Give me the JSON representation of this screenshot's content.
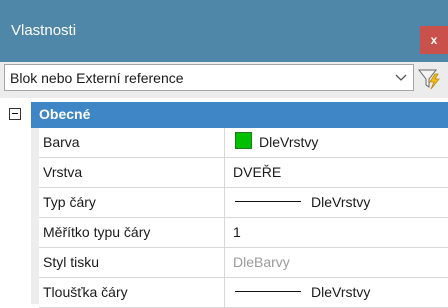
{
  "panel": {
    "title": "Vlastnosti",
    "close_glyph": "x"
  },
  "selector": {
    "value": "Blok nebo Externí reference",
    "chevron_icon": "chevron-down-icon",
    "quick_select_icon": "funnel-lightning-icon"
  },
  "category": {
    "label": "Obecné",
    "expander": "collapse-minus-icon"
  },
  "properties": [
    {
      "name": "Barva",
      "value": "DleVrstvy",
      "swatch_color": "#00c000"
    },
    {
      "name": "Vrstva",
      "value": "DVEŘE"
    },
    {
      "name": "Typ čáry",
      "value": "DleVrstvy"
    },
    {
      "name": "Měřítko typu čáry",
      "value": "1"
    },
    {
      "name": "Styl tisku",
      "value": "DleBarvy"
    },
    {
      "name": "Tloušťka čáry",
      "value": "DleVrstvy"
    }
  ],
  "colors": {
    "titlebar": "#4f87a9",
    "category": "#3e86c6",
    "close": "#c9504b"
  }
}
